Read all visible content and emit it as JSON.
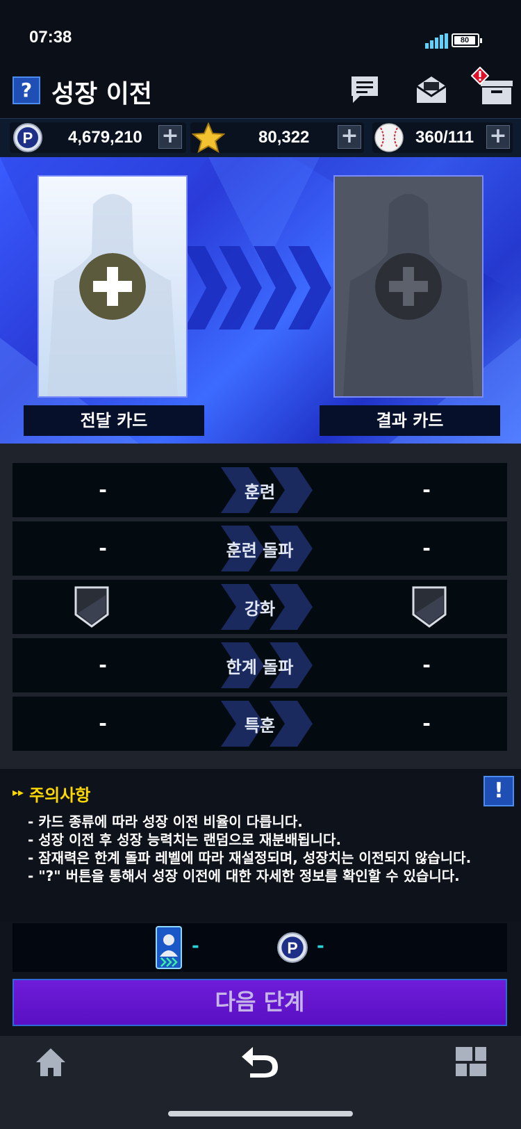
{
  "status_bar": {
    "time": "07:38",
    "battery": "80"
  },
  "header": {
    "help_label": "?",
    "title": "성장 이전"
  },
  "icons": {
    "help": "question-icon",
    "chat": "chat-icon",
    "mail": "mail-icon",
    "inbox": "inbox-icon",
    "alert": "alert-icon",
    "points": "points-coin-icon",
    "star": "star-icon",
    "baseball": "baseball-icon",
    "home": "home-icon",
    "back": "back-arrow-icon",
    "menu": "grid-menu-icon"
  },
  "currency": [
    {
      "value": "4,679,210",
      "plus": "+"
    },
    {
      "value": "80,322",
      "plus": "+"
    },
    {
      "value": "360/111",
      "plus": "+"
    }
  ],
  "cards": {
    "source_label": "전달 카드",
    "result_label": "결과 카드"
  },
  "stats": [
    {
      "left": "-",
      "label": "훈련",
      "right": "-"
    },
    {
      "left": "-",
      "label": "훈련 돌파",
      "right": "-"
    },
    {
      "left": "",
      "label": "강화",
      "right": ""
    },
    {
      "left": "-",
      "label": "한계 돌파",
      "right": "-"
    },
    {
      "left": "-",
      "label": "특훈",
      "right": "-"
    }
  ],
  "notice": {
    "title": "주의사항",
    "button": "!",
    "lines": [
      "- 카드 종류에 따라 성장 이전 비율이 다릅니다.",
      "- 성장 이전 후 성장 능력치는 랜덤으로 재분배됩니다.",
      "- 잠재력은 한계 돌파 레벨에 따라 재설정되며, 성장치는 이전되지 않습니다.",
      "- \"?\" 버튼을 통해서 성장 이전에 대한 자세한 정보를 확인할 수 있습니다."
    ]
  },
  "cost": {
    "card_cost": "-",
    "points_cost": "-"
  },
  "next_button": "다음 단계",
  "colors": {
    "accent_blue": "#1f4fb5",
    "notice_yellow": "#ffd800",
    "cost_cyan": "#29d3d8",
    "next_purple": "#6e1cd8"
  }
}
